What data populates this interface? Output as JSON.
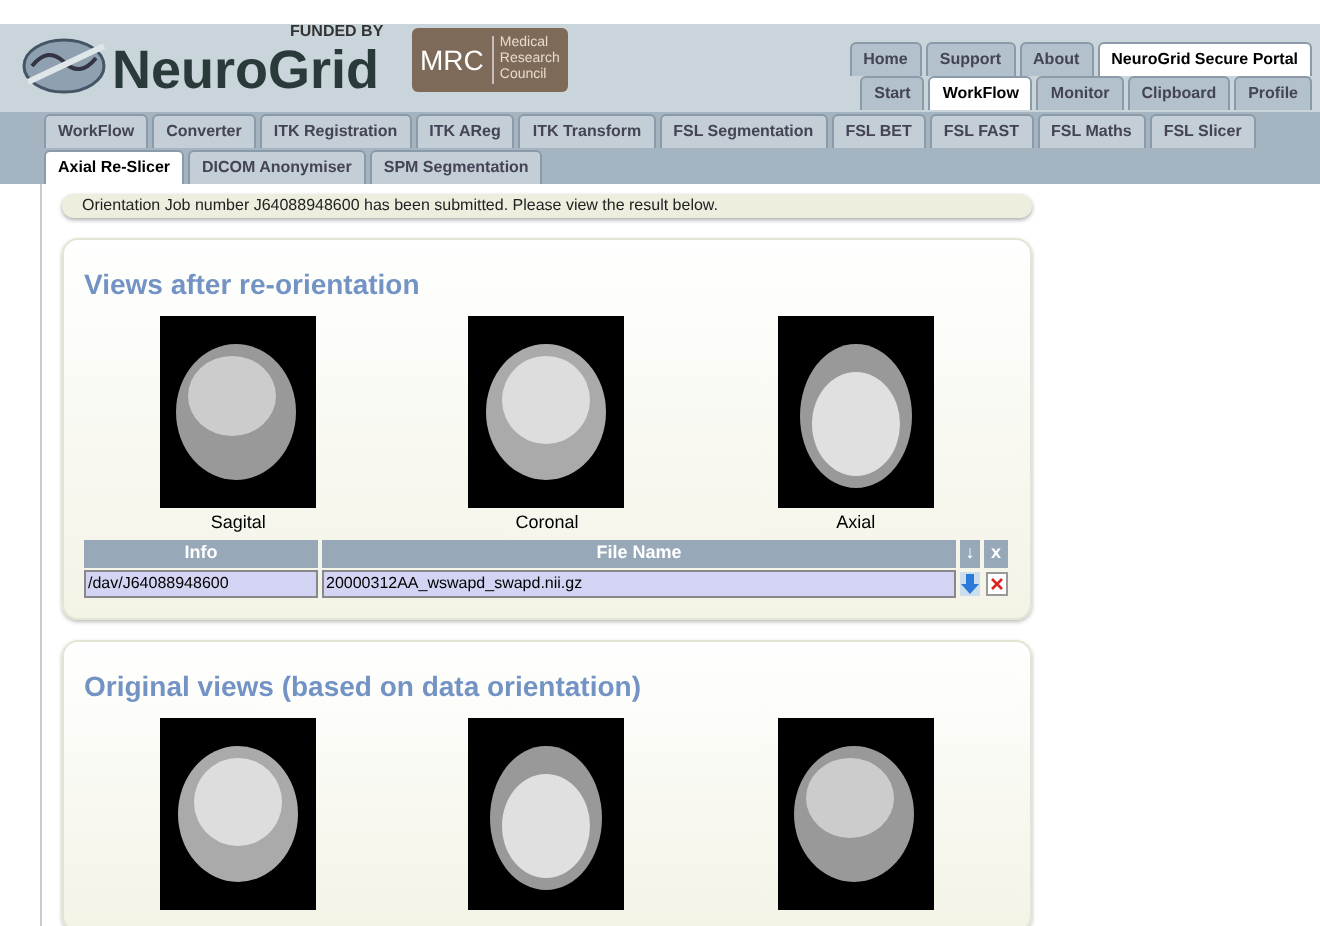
{
  "header": {
    "logo_text": "NeuroGrid",
    "funded_by": "FUNDED BY",
    "mrc_text": "MRC",
    "mrc_lines": [
      "Medical",
      "Research",
      "Council"
    ]
  },
  "portal_tabs": [
    [
      {
        "label": "Home",
        "selected": false
      },
      {
        "label": "Support",
        "selected": false
      },
      {
        "label": "About",
        "selected": false
      },
      {
        "label": "NeuroGrid Secure Portal",
        "selected": true
      }
    ],
    [
      {
        "label": "Start",
        "selected": false
      },
      {
        "label": "WorkFlow",
        "selected": true
      },
      {
        "label": "Monitor",
        "selected": false
      },
      {
        "label": "Clipboard",
        "selected": false
      },
      {
        "label": "Profile",
        "selected": false
      }
    ]
  ],
  "tool_tabs": [
    [
      {
        "label": "WorkFlow",
        "selected": false
      },
      {
        "label": "Converter",
        "selected": false
      },
      {
        "label": "ITK Registration",
        "selected": false
      },
      {
        "label": "ITK AReg",
        "selected": false
      },
      {
        "label": "ITK Transform",
        "selected": false
      },
      {
        "label": "FSL Segmentation",
        "selected": false
      },
      {
        "label": "FSL BET",
        "selected": false
      },
      {
        "label": "FSL FAST",
        "selected": false
      },
      {
        "label": "FSL Maths",
        "selected": false
      },
      {
        "label": "FSL Slicer",
        "selected": false
      }
    ],
    [
      {
        "label": "Axial Re-Slicer",
        "selected": true
      },
      {
        "label": "DICOM Anonymiser",
        "selected": false
      },
      {
        "label": "SPM Segmentation",
        "selected": false
      }
    ]
  ],
  "message": "Orientation Job number J64088948600 has been submitted. Please view the result below.",
  "sections": [
    {
      "title": "Views after re-orientation",
      "images": [
        {
          "caption": "Sagital",
          "kind": "sagittal"
        },
        {
          "caption": "Coronal",
          "kind": "coronal"
        },
        {
          "caption": "Axial",
          "kind": "axial"
        }
      ],
      "table": {
        "columns": [
          "Info",
          "File Name",
          "↓",
          "x"
        ],
        "rows": [
          {
            "info": "/dav/J64088948600",
            "file_name": "20000312AA_wswapd_swapd.nii.gz"
          }
        ]
      }
    },
    {
      "title": "Original views (based on data orientation)",
      "images": [
        {
          "kind": "coronal"
        },
        {
          "kind": "axial"
        },
        {
          "kind": "sagittal"
        }
      ]
    }
  ]
}
